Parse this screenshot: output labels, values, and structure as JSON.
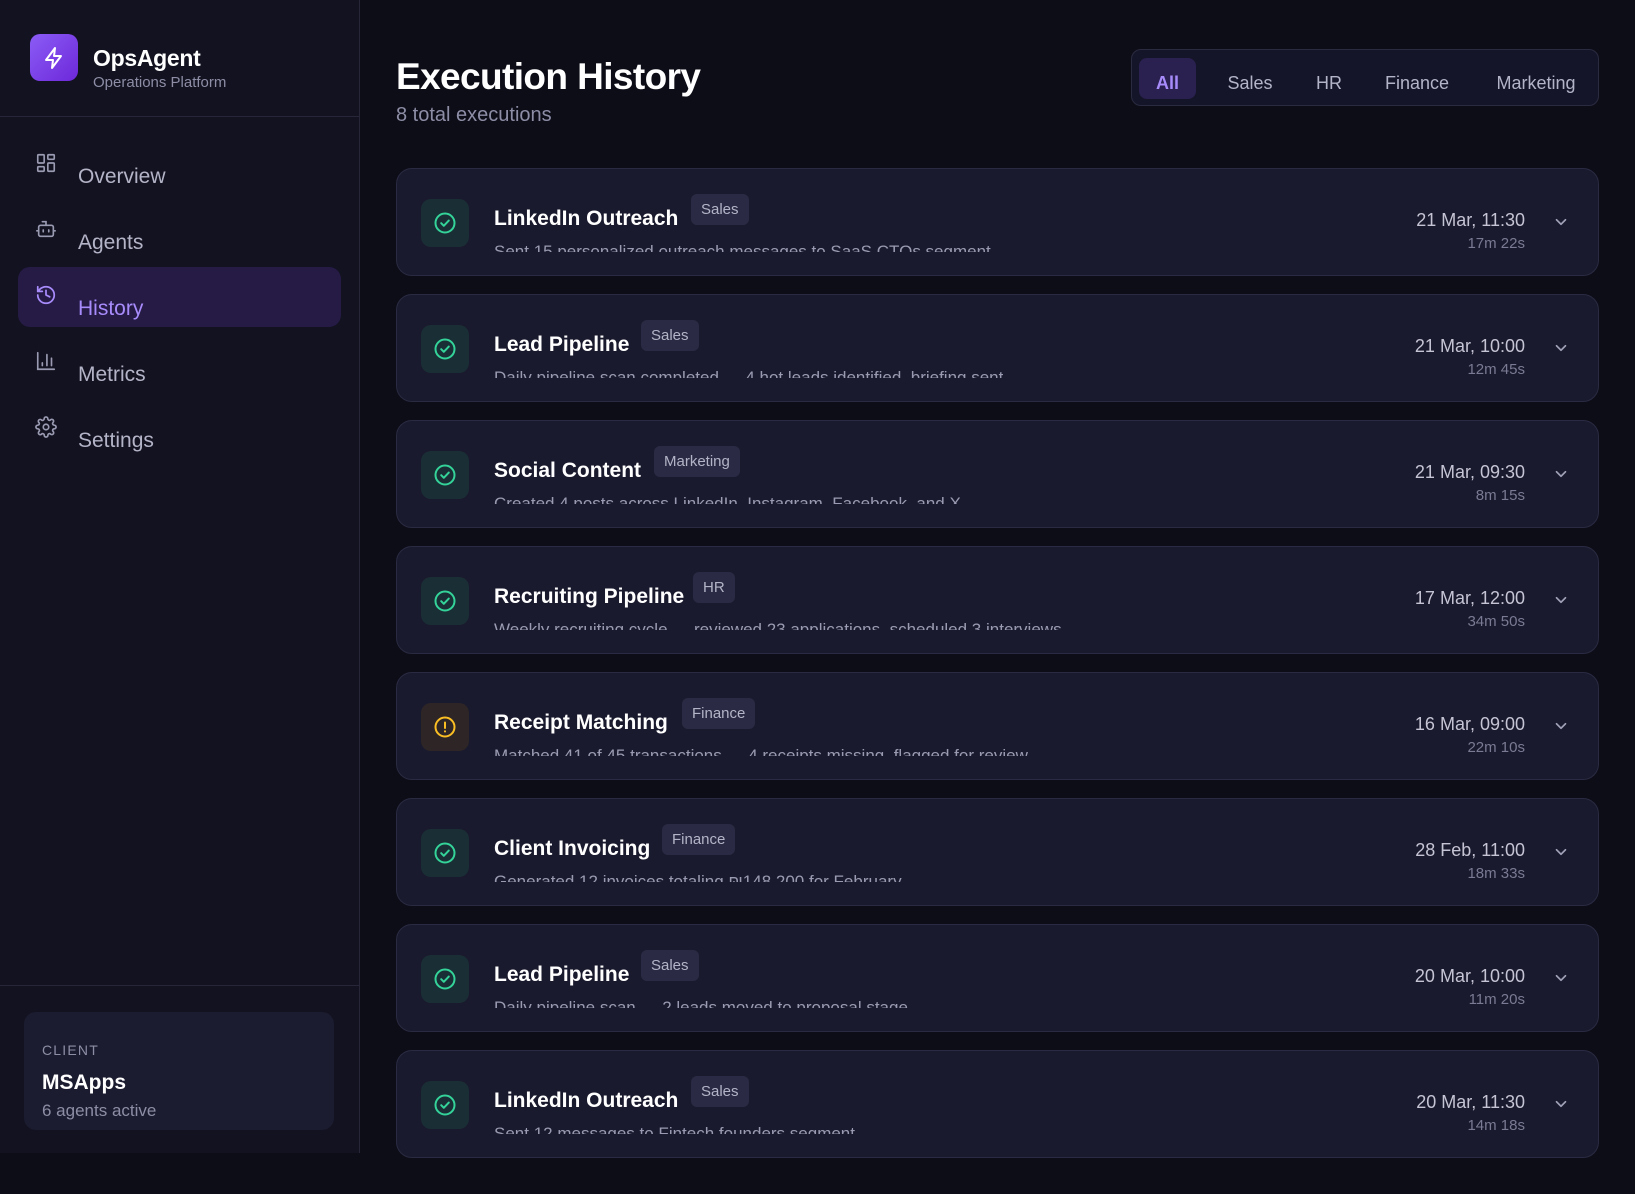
{
  "brand": {
    "name": "OpsAgent",
    "subtitle": "Operations Platform",
    "logo_icon": "lightning-icon",
    "accent": "#8b5cf6"
  },
  "nav": [
    {
      "label": "Overview",
      "icon": "grid-icon",
      "active": false
    },
    {
      "label": "Agents",
      "icon": "bot-icon",
      "active": false
    },
    {
      "label": "History",
      "icon": "history-icon",
      "active": true
    },
    {
      "label": "Metrics",
      "icon": "bar-chart-icon",
      "active": false
    },
    {
      "label": "Settings",
      "icon": "gear-icon",
      "active": false
    }
  ],
  "client": {
    "eyebrow": "CLIENT",
    "name": "MSApps",
    "status": "6 agents active"
  },
  "page": {
    "title": "Execution History",
    "subtitle": "8 total executions"
  },
  "filters": [
    {
      "label": "All",
      "active": true
    },
    {
      "label": "Sales",
      "active": false
    },
    {
      "label": "HR",
      "active": false
    },
    {
      "label": "Finance",
      "active": false
    },
    {
      "label": "Marketing",
      "active": false
    }
  ],
  "colors": {
    "success": "#34d399",
    "warning": "#fbbf24"
  },
  "executions": [
    {
      "title": "LinkedIn Outreach",
      "tag": "Sales",
      "desc": "Sent 15 personalized outreach messages to SaaS CTOs segment",
      "date": "21 Mar, 11:30",
      "duration": "17m 22s",
      "status": "success"
    },
    {
      "title": "Lead Pipeline",
      "tag": "Sales",
      "desc": "Daily pipeline scan completed — 4 hot leads identified, briefing sent",
      "date": "21 Mar, 10:00",
      "duration": "12m 45s",
      "status": "success"
    },
    {
      "title": "Social Content",
      "tag": "Marketing",
      "desc": "Created 4 posts across LinkedIn, Instagram, Facebook, and X",
      "date": "21 Mar, 09:30",
      "duration": "8m 15s",
      "status": "success"
    },
    {
      "title": "Recruiting Pipeline",
      "tag": "HR",
      "desc": "Weekly recruiting cycle — reviewed 23 applications, scheduled 3 interviews",
      "date": "17 Mar, 12:00",
      "duration": "34m 50s",
      "status": "success"
    },
    {
      "title": "Receipt Matching",
      "tag": "Finance",
      "desc": "Matched 41 of 45 transactions — 4 receipts missing, flagged for review",
      "date": "16 Mar, 09:00",
      "duration": "22m 10s",
      "status": "warning"
    },
    {
      "title": "Client Invoicing",
      "tag": "Finance",
      "desc": "Generated 12 invoices totaling ₪148,200 for February",
      "date": "28 Feb, 11:00",
      "duration": "18m 33s",
      "status": "success"
    },
    {
      "title": "Lead Pipeline",
      "tag": "Sales",
      "desc": "Daily pipeline scan — 2 leads moved to proposal stage",
      "date": "20 Mar, 10:00",
      "duration": "11m 20s",
      "status": "success"
    },
    {
      "title": "LinkedIn Outreach",
      "tag": "Sales",
      "desc": "Sent 12 messages to Fintech founders segment",
      "date": "20 Mar, 11:30",
      "duration": "14m 18s",
      "status": "success"
    }
  ]
}
